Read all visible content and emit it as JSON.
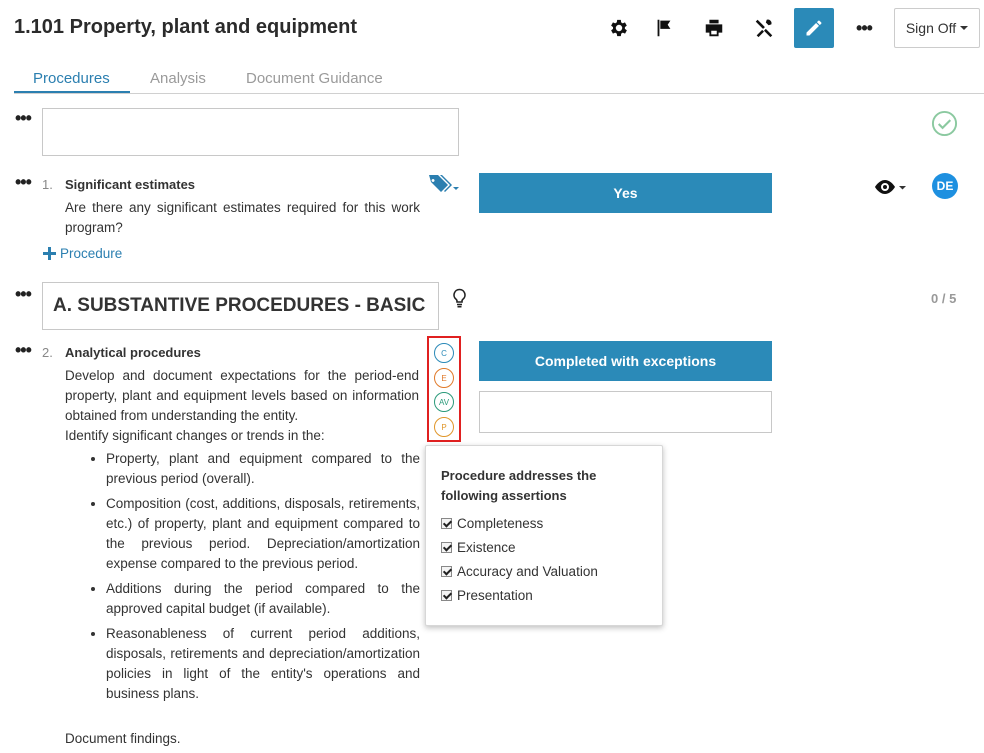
{
  "header": {
    "title": "1.101 Property, plant and equipment",
    "sign_off_label": "Sign Off",
    "icons": [
      "gear-icon",
      "flag-icon",
      "print-icon",
      "tools-icon",
      "pencil-icon",
      "more-icon"
    ],
    "accent_color": "#2b8ab8"
  },
  "tabs": [
    {
      "label": "Procedures",
      "active": true
    },
    {
      "label": "Analysis",
      "active": false
    },
    {
      "label": "Document Guidance",
      "active": false
    }
  ],
  "item1": {
    "number": "1.",
    "title": "Significant estimates",
    "question": "Are there any significant estimates required for this work program?",
    "answer": "Yes",
    "avatar": "DE"
  },
  "add_procedure_label": "Procedure",
  "section": {
    "title": "A. SUBSTANTIVE PROCEDURES - BASIC",
    "counter": "0 / 5"
  },
  "item2": {
    "number": "2.",
    "title": "Analytical procedures",
    "intro": "Develop and document expectations for the period-end property, plant and equipment levels based on information obtained from understanding the entity.",
    "lead": "Identify significant changes or trends in the:",
    "bullets": [
      "Property, plant and equipment compared to the previous period (overall).",
      "Composition (cost, additions, disposals, retirements, etc.) of property, plant and equipment compared to the previous period. Depreciation/amortization expense compared to the previous period.",
      "Additions during the period compared to the approved capital budget (if available).",
      "Reasonableness of current period additions, disposals, retirements and depreciation/amortization policies in light of the entity's operations and business plans."
    ],
    "footer": "Document findings.",
    "answer": "Completed with exceptions",
    "assertions": [
      {
        "code": "C",
        "color": "#2b8ab8"
      },
      {
        "code": "E",
        "color": "#e07a2a"
      },
      {
        "code": "AV",
        "color": "#2a9a7a"
      },
      {
        "code": "P",
        "color": "#e0962a"
      }
    ]
  },
  "popup": {
    "title": "Procedure addresses the following assertions",
    "items": [
      "Completeness",
      "Existence",
      "Accuracy and Valuation",
      "Presentation"
    ]
  }
}
